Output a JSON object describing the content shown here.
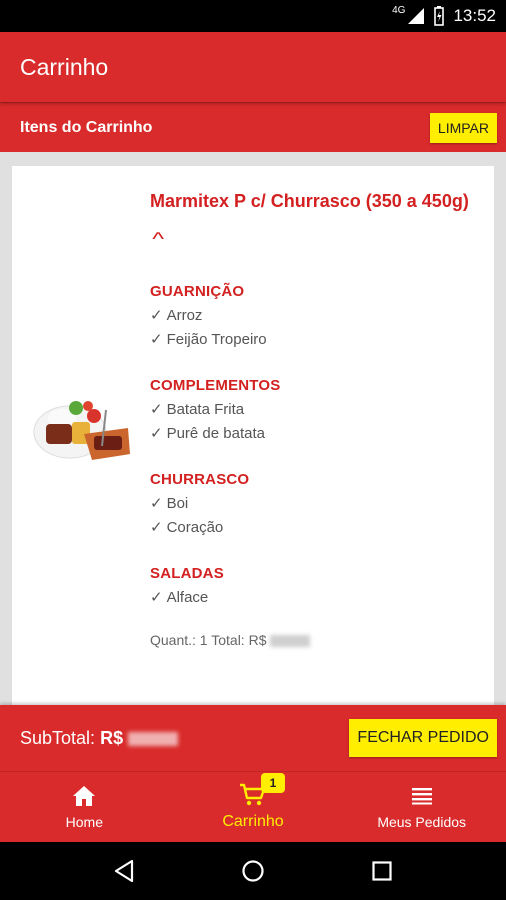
{
  "status_bar": {
    "network": "4G",
    "time": "13:52"
  },
  "app_bar": {
    "title": "Carrinho"
  },
  "cart_header": {
    "title": "Itens do Carrinho",
    "clear_label": "LIMPAR"
  },
  "item": {
    "name": "Marmitex P c/ Churrasco (350 a 450g)",
    "image_icon": "food-plate-image",
    "groups": [
      {
        "title": "GUARNIÇÃO",
        "options": [
          "Arroz",
          "Feijão Tropeiro"
        ]
      },
      {
        "title": "COMPLEMENTOS",
        "options": [
          "Batata Frita",
          "Purê de batata"
        ]
      },
      {
        "title": "CHURRASCO",
        "options": [
          "Boi",
          "Coração"
        ]
      },
      {
        "title": "SALADAS",
        "options": [
          "Alface"
        ]
      }
    ],
    "quantity_label": "Quant.: 1 Total: R$"
  },
  "footer": {
    "subtotal_label": "SubTotal:",
    "subtotal_currency": "R$",
    "checkout_label": "FECHAR PEDIDO"
  },
  "bottom_nav": {
    "items": [
      {
        "label": "Home",
        "icon": "home-icon"
      },
      {
        "label": "Carrinho",
        "icon": "cart-icon",
        "badge": "1"
      },
      {
        "label": "Meus Pedidos",
        "icon": "list-icon"
      }
    ]
  },
  "colors": {
    "primary": "#d92b2b",
    "accent": "#ffee00",
    "title_red": "#d32020"
  }
}
